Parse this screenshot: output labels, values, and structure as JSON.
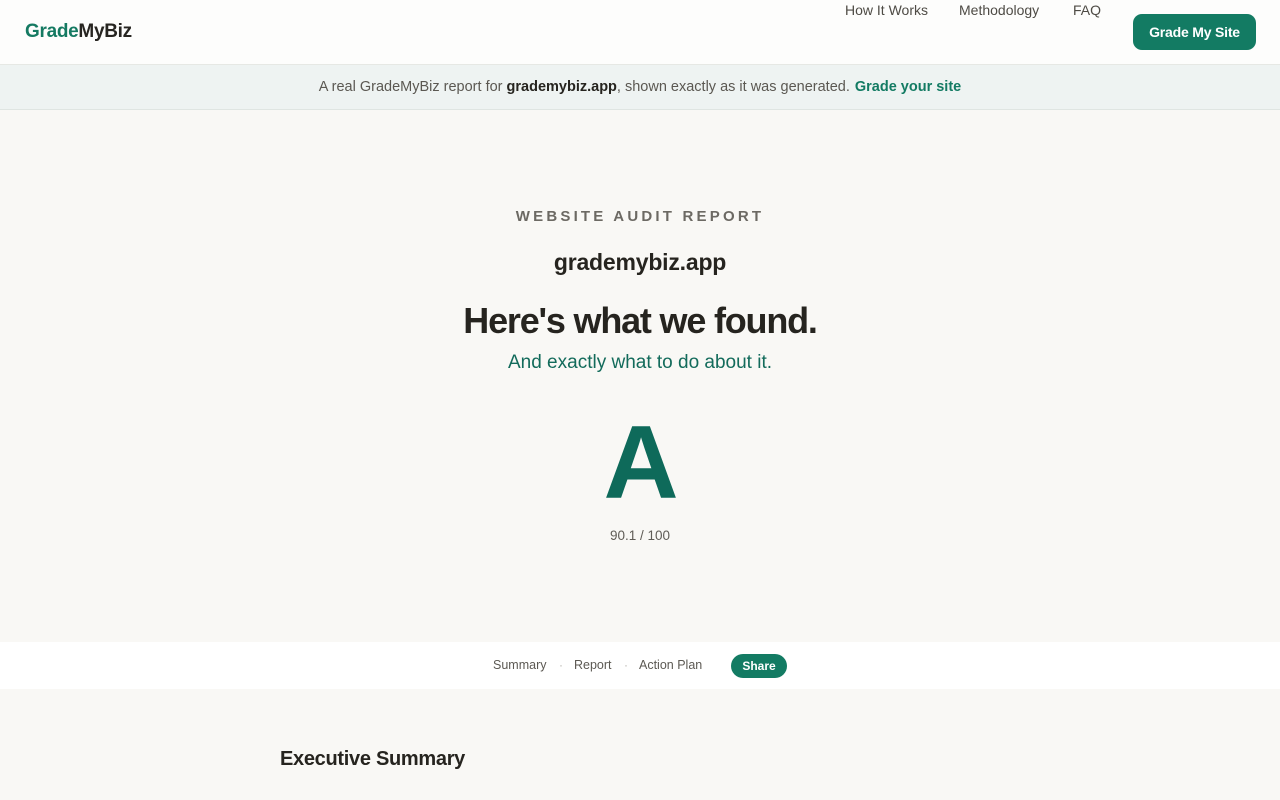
{
  "nav": {
    "logo_part1": "Grade",
    "logo_part2": "MyBiz",
    "links": [
      "How It Works",
      "Methodology",
      "FAQ"
    ],
    "cta": "Grade My Site"
  },
  "banner": {
    "prefix": "A real GradeMyBiz report for",
    "domain": "grademybiz.app",
    "suffix": ", shown exactly as it was generated.",
    "link": "Grade your site"
  },
  "hero": {
    "eyebrow": "WEBSITE AUDIT REPORT",
    "domain": "grademybiz.app",
    "headline": "Here's what we found.",
    "subhead": "And exactly what to do about it.",
    "grade": "A",
    "score": "90.1 / 100"
  },
  "subnav": {
    "items": [
      "Summary",
      "Report",
      "Action Plan"
    ],
    "separator": "·",
    "share": "Share"
  },
  "content": {
    "section_title": "Executive Summary"
  },
  "colors": {
    "brand_green": "#137b63",
    "grade_green": "#0e6a5a",
    "background": "#f9f8f5",
    "banner_bg": "#eef3f2"
  }
}
